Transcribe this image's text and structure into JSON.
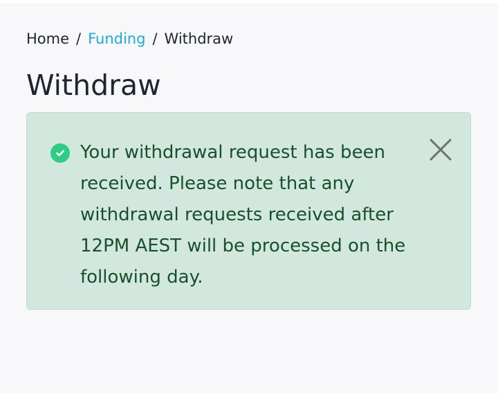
{
  "breadcrumb": {
    "home": "Home",
    "separator": "/",
    "funding": "Funding",
    "current": "Withdraw"
  },
  "page": {
    "title": "Withdraw"
  },
  "alert": {
    "icon": "check-circle-icon",
    "message": "Your withdrawal request has been received. Please note that any withdrawal requests received after 12PM AEST will be processed on the following day.",
    "close_icon": "close-icon"
  },
  "colors": {
    "link": "#1fa9d8",
    "text": "#1d2630",
    "alert_background": "#d2e7dd",
    "alert_text": "#18502d",
    "success": "#2ecc84"
  }
}
